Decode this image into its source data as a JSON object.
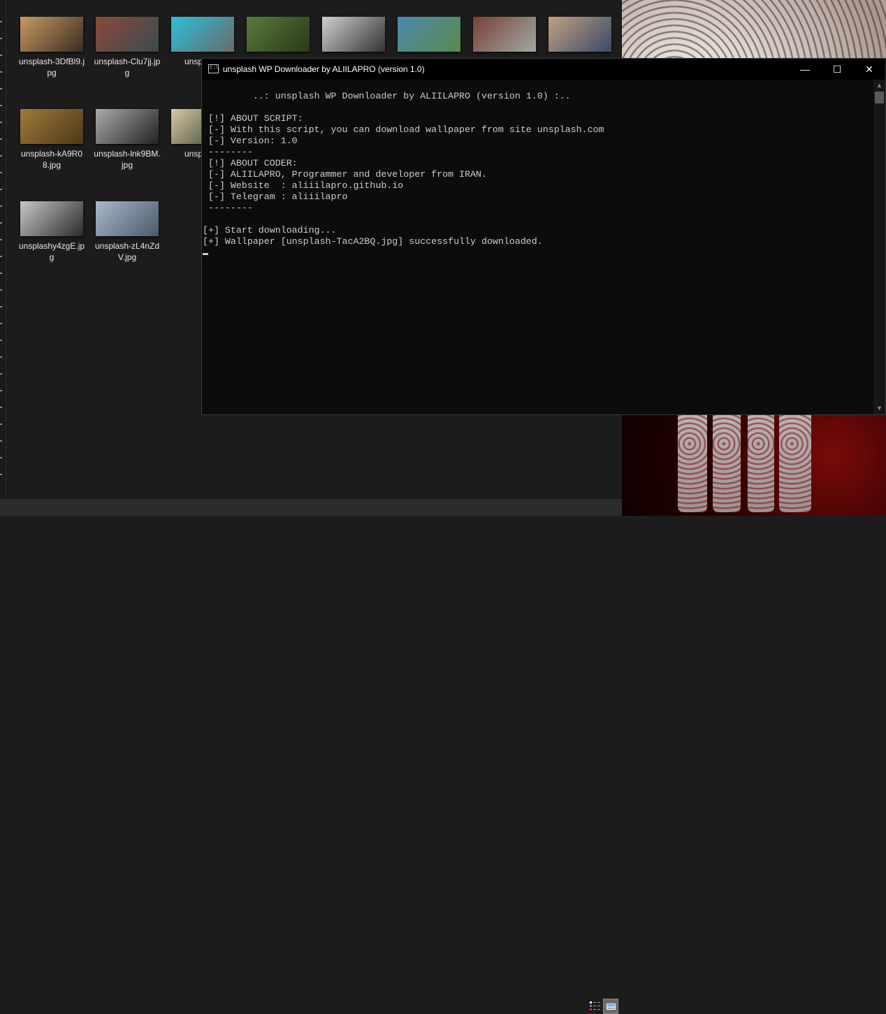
{
  "explorer": {
    "files": [
      {
        "name": "unsplash-3DfBl9.jpg",
        "colors": [
          "#c89a62",
          "#3a2d24"
        ]
      },
      {
        "name": "unsplash-Clu7jj.jpg",
        "colors": [
          "#8a4a3a",
          "#3b4a50"
        ]
      },
      {
        "name": "unsplash-",
        "colors": [
          "#2ac0d8",
          "#6a6a6a"
        ]
      },
      {
        "name": "",
        "colors": [
          "#5a7a3a",
          "#2a3a1a"
        ]
      },
      {
        "name": "",
        "colors": [
          "#d0d0d0",
          "#333"
        ]
      },
      {
        "name": "",
        "colors": [
          "#4a8ab0",
          "#5a8a4a"
        ]
      },
      {
        "name": "",
        "colors": [
          "#7a4038",
          "#a0a8a0"
        ]
      },
      {
        "name": "",
        "colors": [
          "#c0a080",
          "#3a4a6a"
        ]
      },
      {
        "name": "unsplash-kA9R08.jpg",
        "colors": [
          "#a07a3a",
          "#4a3a1a"
        ]
      },
      {
        "name": "unsplash-lnk9BM.jpg",
        "colors": [
          "#aaa",
          "#222"
        ]
      },
      {
        "name": "unsplash-",
        "colors": [
          "#d8c8a8",
          "#2a3a2a"
        ]
      },
      {
        "name": "unsplashy4zgE.jpg",
        "colors": [
          "#c8c8c8",
          "#2a2a28"
        ]
      },
      {
        "name": "unsplash-zL4nZdV.jpg",
        "colors": [
          "#a8b8c8",
          "#4a5a6a"
        ]
      }
    ],
    "view_buttons": [
      "details-view",
      "thumbnails-view"
    ]
  },
  "console": {
    "title": "unsplash WP Downloader by ALIILAPRO (version 1.0)",
    "controls": {
      "minimize": "—",
      "maximize": "☐",
      "close": "✕"
    },
    "icon_text": "C:\\_",
    "lines": [
      "         ..: unsplash WP Downloader by ALIILAPRO (version 1.0) :..",
      "",
      " [!] ABOUT SCRIPT:",
      " [-] With this script, you can download wallpaper from site unsplash.com",
      " [-] Version: 1.0",
      " --------",
      " [!] ABOUT CODER:",
      " [-] ALIILAPRO, Programmer and developer from IRAN.",
      " [-] Website  : aliiilapro.github.io",
      " [-] Telegram : aliiilapro",
      " --------",
      "",
      "[+] Start downloading...",
      "[+] Wallpaper [unsplash-TacA2BQ.jpg] successfully downloaded."
    ],
    "text_color": "#cccccc",
    "background": "#0c0c0c"
  }
}
